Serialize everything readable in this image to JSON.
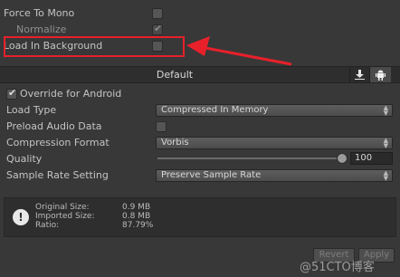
{
  "settings": {
    "force_to_mono": "Force To Mono",
    "normalize": "Normalize",
    "load_in_background": "Load In Background"
  },
  "tabs": {
    "default": "Default",
    "download_icon": "download-icon",
    "android_icon": "android-icon"
  },
  "override": {
    "label": "Override for Android",
    "load_type_label": "Load Type",
    "load_type_value": "Compressed In Memory",
    "preload_label": "Preload Audio Data",
    "compression_label": "Compression Format",
    "compression_value": "Vorbis",
    "quality_label": "Quality",
    "quality_value": "100",
    "quality_fraction": 1.0,
    "sample_rate_label": "Sample Rate Setting",
    "sample_rate_value": "Preserve Sample Rate"
  },
  "info": {
    "original_label": "Original Size:",
    "original_value": "0.9 MB",
    "imported_label": "Imported Size:",
    "imported_value": "0.8 MB",
    "ratio_label": "Ratio:",
    "ratio_value": "87.79%"
  },
  "buttons": {
    "revert": "Revert",
    "apply": "Apply"
  },
  "watermark": "@51CTO博客",
  "colors": {
    "highlight": "#e8202a",
    "panel_bg": "#383838"
  }
}
